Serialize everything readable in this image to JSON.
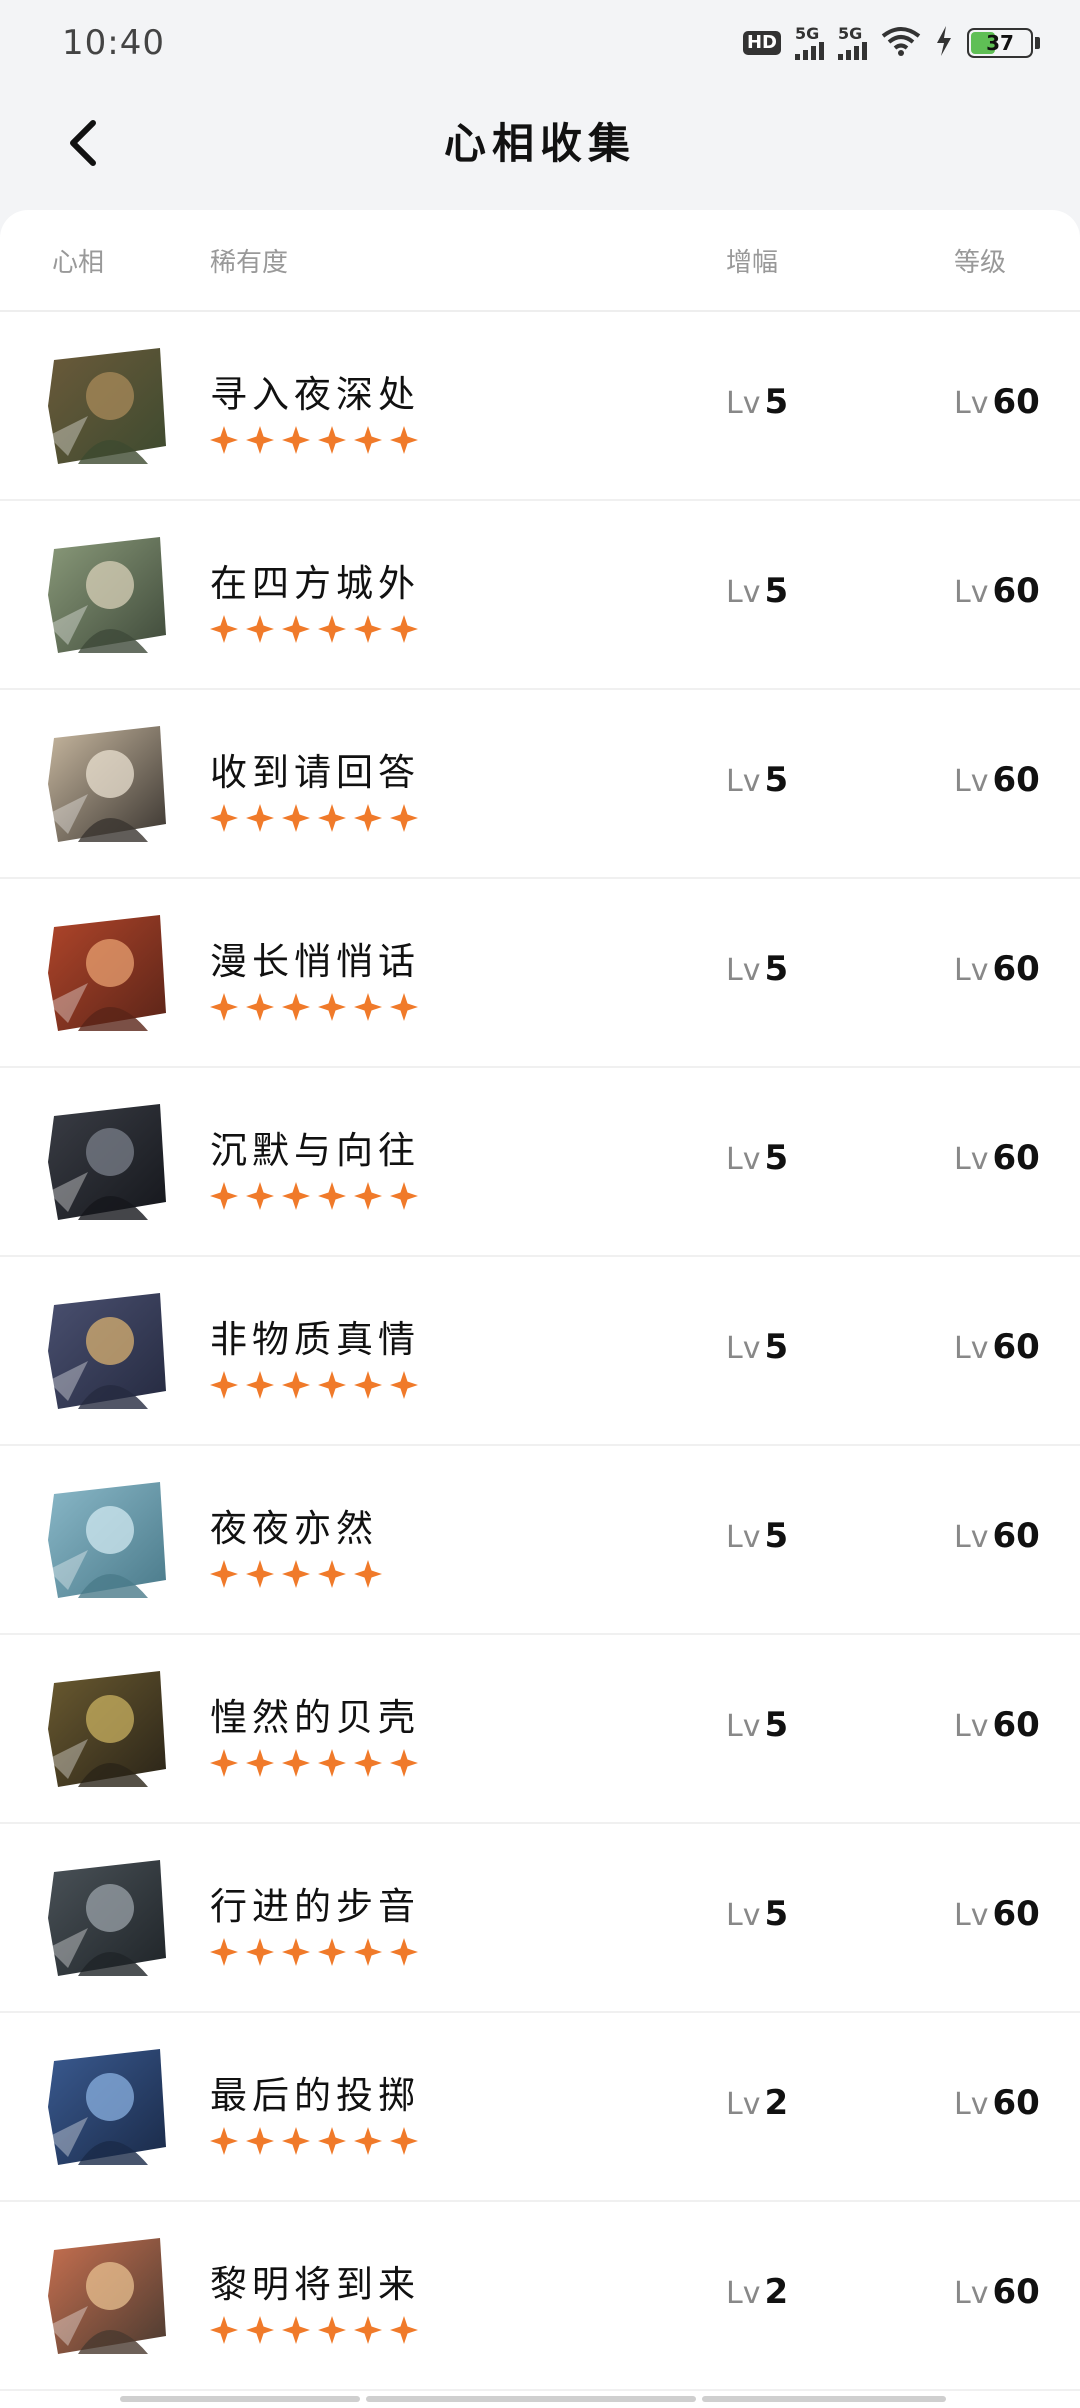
{
  "status_bar": {
    "time": "10:40",
    "hd_label": "HD",
    "signal1_label": "5G",
    "signal2_label": "5G",
    "battery_level": "37"
  },
  "header": {
    "title": "心相收集",
    "back_icon": "chevron-left-icon"
  },
  "table": {
    "columns": [
      "心相",
      "稀有度",
      "增幅",
      "等级"
    ],
    "lv_prefix": "Lv",
    "rows": [
      {
        "name": "寻入夜深处",
        "stars": 6,
        "amp": "5",
        "level": "60"
      },
      {
        "name": "在四方城外",
        "stars": 6,
        "amp": "5",
        "level": "60"
      },
      {
        "name": "收到请回答",
        "stars": 6,
        "amp": "5",
        "level": "60"
      },
      {
        "name": "漫长悄悄话",
        "stars": 6,
        "amp": "5",
        "level": "60"
      },
      {
        "name": "沉默与向往",
        "stars": 6,
        "amp": "5",
        "level": "60"
      },
      {
        "name": "非物质真情",
        "stars": 6,
        "amp": "5",
        "level": "60"
      },
      {
        "name": "夜夜亦然",
        "stars": 5,
        "amp": "5",
        "level": "60"
      },
      {
        "name": "惶然的贝壳",
        "stars": 6,
        "amp": "5",
        "level": "60"
      },
      {
        "name": "行进的步音",
        "stars": 6,
        "amp": "5",
        "level": "60"
      },
      {
        "name": "最后的投掷",
        "stars": 6,
        "amp": "2",
        "level": "60"
      },
      {
        "name": "黎明将到来",
        "stars": 6,
        "amp": "2",
        "level": "60"
      }
    ]
  },
  "colors": {
    "star": "#f07a2a",
    "avatars": [
      [
        "#6b5a3a",
        "#3d4a2f",
        "#a88a5a"
      ],
      [
        "#8a9a7a",
        "#3f4a3a",
        "#d8d0b8"
      ],
      [
        "#c8b8a0",
        "#3a3530",
        "#eae0d0"
      ],
      [
        "#b0452a",
        "#5a2418",
        "#e8a070"
      ],
      [
        "#3a3d45",
        "#15171c",
        "#7a7f8a"
      ],
      [
        "#4a5070",
        "#252a40",
        "#d8b070"
      ],
      [
        "#8ab8c8",
        "#4a7a8a",
        "#d0e8f0"
      ],
      [
        "#6a5a30",
        "#2a2418",
        "#c8b060"
      ],
      [
        "#4a5258",
        "#1f2428",
        "#9aa2a8"
      ],
      [
        "#3a5a90",
        "#1a2a48",
        "#8ab0e0"
      ],
      [
        "#c87050",
        "#4a3a30",
        "#e8c090"
      ]
    ]
  }
}
